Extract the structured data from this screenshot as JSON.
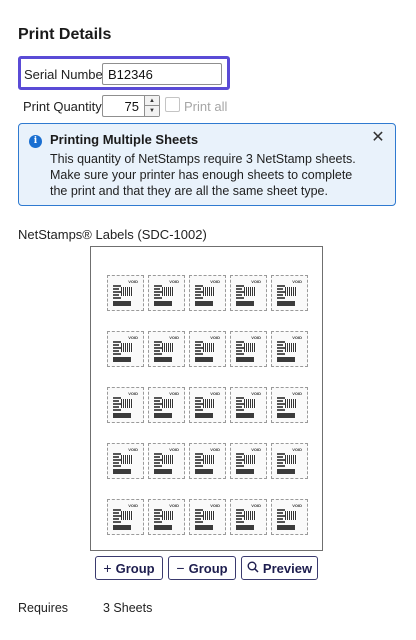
{
  "panel": {
    "title": "Print Details"
  },
  "serial": {
    "label": "Serial Number",
    "value": "B12346"
  },
  "quantity": {
    "label": "Print Quantity",
    "value": "75",
    "print_all_label": "Print all"
  },
  "alert": {
    "icon": "info-icon",
    "title": "Printing Multiple Sheets",
    "body": "This quantity of NetStamps require 3 NetStamp sheets. Make sure your printer has enough sheets to complete the print and that they are all the same sheet type.",
    "close_symbol": "✕"
  },
  "sheet": {
    "label": "NetStamps® Labels (SDC-1002)",
    "rows": 5,
    "cols": 5,
    "stamp_text": "VOID"
  },
  "buttons": {
    "add_group": {
      "icon": "+",
      "label": "Group"
    },
    "remove_group": {
      "icon": "−",
      "label": "Group"
    },
    "preview": {
      "icon": "search-icon",
      "label": "Preview"
    }
  },
  "requires": {
    "label": "Requires",
    "value": "3 Sheets"
  },
  "colors": {
    "accent": "#5a4bd6",
    "info": "#1a6fd1",
    "alert_bg": "#e9f2fb",
    "button_text": "#1d1d4e"
  }
}
